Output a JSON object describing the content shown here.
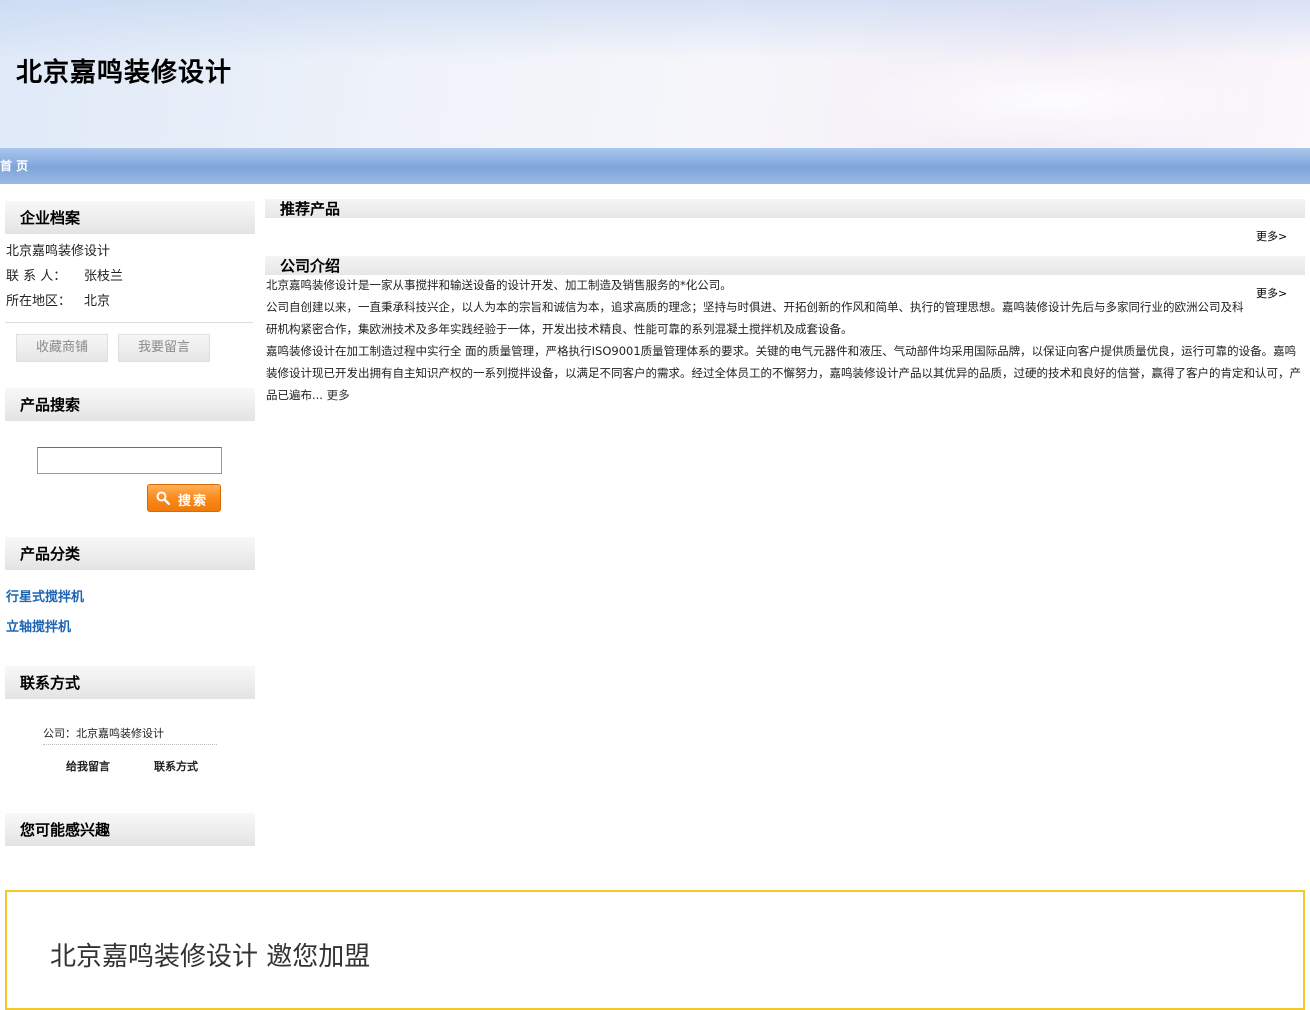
{
  "header": {
    "site_title": "北京嘉鸣装修设计"
  },
  "nav": {
    "home": "首 页"
  },
  "sidebar": {
    "profile": {
      "heading": "企业档案",
      "company": "北京嘉鸣装修设计",
      "contact_label": "联 系 人：",
      "contact_value": "张枝兰",
      "region_label": "所在地区：",
      "region_value": "北京",
      "favorite_button": "收藏商铺",
      "message_button": "我要留言"
    },
    "search": {
      "heading": "产品搜索",
      "input_value": "",
      "button_label": "搜索"
    },
    "categories": {
      "heading": "产品分类",
      "items": [
        "行星式搅拌机",
        "立轴搅拌机"
      ]
    },
    "contact": {
      "heading": "联系方式",
      "company_line": "公司：北京嘉鸣装修设计",
      "leave_message": "给我留言",
      "contact_info": "联系方式"
    },
    "interest": {
      "heading": "您可能感兴趣"
    }
  },
  "main": {
    "recommended": {
      "heading": "推荐产品",
      "more": "更多>"
    },
    "intro": {
      "heading": "公司介绍",
      "more": "更多>",
      "paragraphs": [
        "北京嘉鸣装修设计是一家从事搅拌和输送设备的设计开发、加工制造及销售服务的*化公司。",
        "公司自创建以来，一直秉承科技兴企，以人为本的宗旨和诚信为本，追求高质的理念；坚持与时俱进、开拓创新的作风和简单、执行的管理思想。嘉鸣装修设计先后与多家同行业的欧洲公司及科研机构紧密合作，集欧洲技术及多年实践经验于一体，开发出技术精良、性能可靠的系列混凝土搅拌机及成套设备。",
        "嘉鸣装修设计在加工制造过程中实行全 面的质量管理，严格执行ISO9001质量管理体系的要求。关键的电气元器件和液压、气动部件均采用国际品牌，以保证向客户提供质量优良，运行可靠的设备。嘉鸣装修设计现已开发出拥有自主知识产权的一系列搅拌设备，以满足不同客户的需求。经过全体员工的不懈努力，嘉鸣装修设计产品以其优异的品质，过硬的技术和良好的信誉，赢得了客户的肯定和认可，产品已遍布..."
      ],
      "inline_more": "更多"
    }
  },
  "footer": {
    "join_title": "北京嘉鸣装修设计 邀您加盟"
  },
  "colors": {
    "nav_blue": "#86abde",
    "link_blue": "#1e64b4",
    "search_orange": "#f98a1c",
    "footer_border": "#f2c928"
  },
  "icons": {
    "search_button": "magnifier-icon"
  }
}
